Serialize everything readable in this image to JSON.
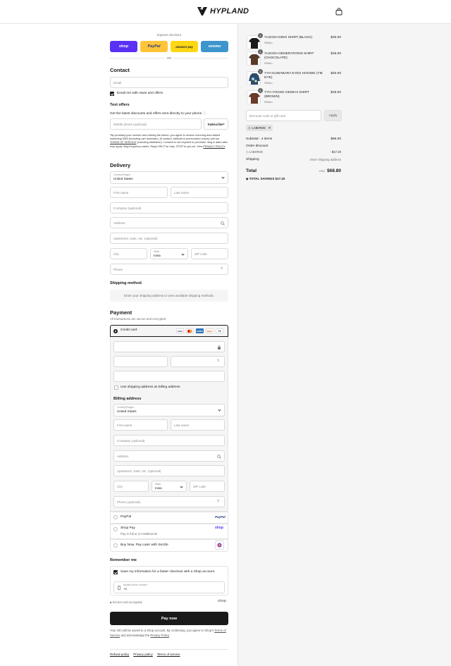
{
  "brand": {
    "name": "HYPLAND"
  },
  "express": {
    "heading": "Express checkout",
    "shop_label": "shop",
    "paypal_label": "PayPal",
    "amazon_label": "amazon pay",
    "venmo_label": "venmo",
    "or_label": "OR"
  },
  "contact": {
    "heading": "Contact",
    "email_placeholder": "Email",
    "news_label": "Email me with news and offers"
  },
  "text_offers": {
    "heading": "Text offers",
    "subtext": "Get the latest discounts and offers sent directly to your phone",
    "phone_placeholder": "Mobile phone (optional)",
    "subscribe_label": "Subscribe*",
    "legal_1": "*By providing your number and clicking the button, you agree to receive recurring auto-dialed marketing SMS (including cart reminders, AI content, artificial or prerecorded voices) and our",
    "legal_link_1": "TERMS OF SERVICE",
    "legal_2": "(including arbitration). Consent is not required to purchase. Msg & data rates may apply. Msg frequency varies. Reply HELP for help, STOP to opt-out. View",
    "legal_link_2": "PRIVACY POLICY",
    "legal_end": "."
  },
  "delivery": {
    "heading": "Delivery",
    "country_label": "Country/Region",
    "country_value": "United States",
    "first_name": "First name",
    "last_name": "Last name",
    "company": "Company (optional)",
    "address": "Address",
    "apartment": "Apartment, suite, etc. (optional)",
    "city": "City",
    "state_label": "State",
    "state_value": "Iowa",
    "zip": "ZIP code",
    "phone": "Phone"
  },
  "shipping": {
    "heading": "Shipping method",
    "note": "Enter your shipping address to view available shipping methods."
  },
  "payment": {
    "heading": "Payment",
    "subtext": "All transactions are secure and encrypted.",
    "credit_card_label": "Credit card",
    "card_logos": [
      "VISA",
      "MC",
      "AMEX",
      "DISC",
      "+4"
    ],
    "use_shipping_label": "Use shipping address as billing address",
    "billing_heading": "Billing address",
    "paypal_label": "PayPal",
    "paypal_logo": "PayPal",
    "shoppay_label": "Shop Pay",
    "shoppay_sub": "Pay in full or in installments",
    "shoppay_logo": "shop",
    "sezzle_label": "Buy Now, Pay Later with Sezzle"
  },
  "remember": {
    "heading": "Remember me",
    "save_label": "Save my information for a faster checkout with a Shop account",
    "mobile_label": "Mobile phone number",
    "mobile_value": "+1",
    "secure_label": "Secure and encrypted",
    "shop_logo": "shop"
  },
  "pay_now": {
    "label": "Pay now",
    "legal_1": "Your info will be saved to a Shop account. By continuing, you agree to Shop’s",
    "tos_link": "Terms of Service",
    "legal_2": "and acknowledge the",
    "privacy_link": "Privacy Policy",
    "legal_end": "."
  },
  "footer": {
    "refund": "Refund policy",
    "privacy": "Privacy policy",
    "terms": "Terms of service"
  },
  "cart": {
    "items": [
      {
        "name": "YUGIOH DINO SHIRT (BLACK)",
        "variant": "SMALL",
        "price": "$30.00",
        "qty": "1",
        "color": "#1a1a1a"
      },
      {
        "name": "YUGIOH GENERATIONS SHIRT (CHOCOLATE)",
        "variant": "SMALL",
        "price": "$18.00",
        "qty": "1",
        "color": "#5a3a28"
      },
      {
        "name": "YYH KUWABARA EYES HOODIE (TIE DYE)",
        "variant": "SMALL",
        "price": "$20.00",
        "qty": "1",
        "color": "#2e4b6b"
      },
      {
        "name": "YYH YOUNG GENKAI SHIRT (BROWN)",
        "variant": "SMALL",
        "price": "$18.00",
        "qty": "1",
        "color": "#6b3a2a"
      }
    ],
    "discount_placeholder": "Discount code or gift card",
    "apply_label": "Apply",
    "applied_code": "LABOR25",
    "subtotal_label": "Subtotal · 4 items",
    "subtotal_value": "$86.00",
    "order_discount_label": "Order discount",
    "discount_code": "LABOR25",
    "discount_value": "- $17.20",
    "shipping_label": "Shipping",
    "shipping_value": "Enter shipping address",
    "total_label": "Total",
    "currency": "USD",
    "total_value": "$68.80",
    "savings_label": "TOTAL SAVINGS",
    "savings_value": "$17.20"
  },
  "colors": {
    "shop": "#5a31f4",
    "paypal": "#ffc439",
    "amazon": "#ffd814",
    "venmo": "#3d95ce",
    "pay_button": "#1a1a1a"
  }
}
